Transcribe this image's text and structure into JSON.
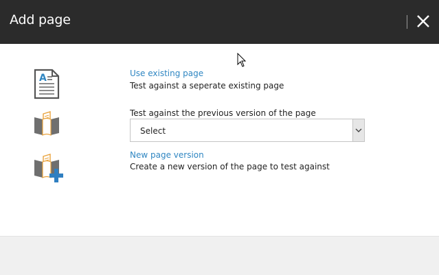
{
  "dialog": {
    "title": "Add page",
    "close_label": "Close"
  },
  "options": [
    {
      "icon": "document-page-icon",
      "link": "Use existing page",
      "description": "Test against a seperate existing page"
    },
    {
      "icon": "page-version-icon",
      "label": "Test against the previous version of the page",
      "select": {
        "selected": "Select"
      }
    },
    {
      "icon": "new-page-version-icon",
      "link": "New page version",
      "description": "Create a new version of the page to test against"
    }
  ],
  "colors": {
    "header_bg": "#2b2b2b",
    "link": "#2f86c2",
    "footer_bg": "#f0f0f0",
    "accent_plus": "#2f7fc1",
    "book_gray": "#6f6f6f",
    "page_orange": "#e9a23b"
  }
}
